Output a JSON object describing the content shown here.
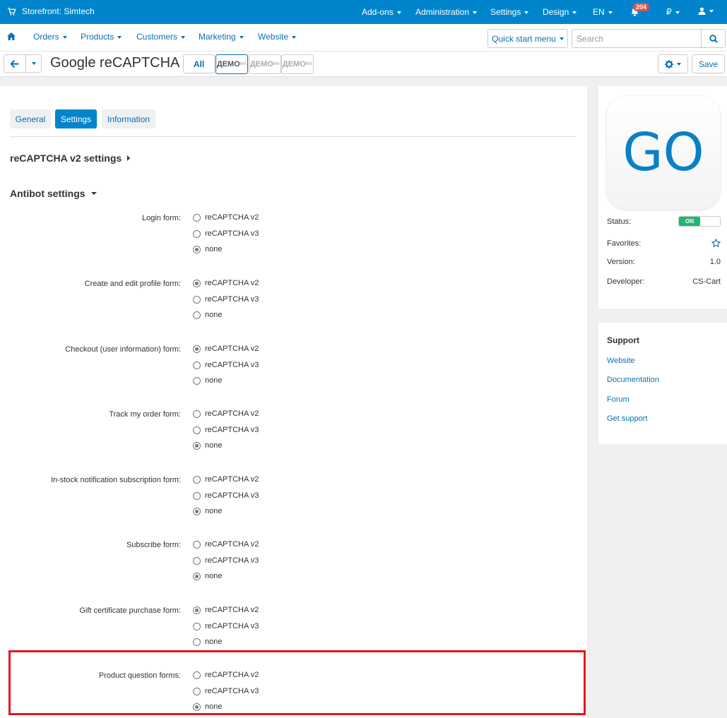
{
  "topbar": {
    "storefront": "Storefront: Simtech",
    "menus": [
      "Add-ons",
      "Administration",
      "Settings",
      "Design",
      "EN"
    ],
    "notifications_count": "204",
    "currency": "₽"
  },
  "nav": {
    "items": [
      "Orders",
      "Products",
      "Customers",
      "Marketing",
      "Website"
    ],
    "quick_start": "Quick start menu",
    "search_placeholder": "Search"
  },
  "header": {
    "title": "Google reCAPTCHA",
    "all_label": "All",
    "demo_label": "ДЕМО",
    "save_label": "Save"
  },
  "tabs": [
    "General",
    "Settings",
    "Information"
  ],
  "sections": {
    "recaptcha_v2": "reCAPTCHA v2 settings",
    "antibot": "Antibot settings"
  },
  "option_labels": [
    "reCAPTCHA v2",
    "reCAPTCHA v3",
    "none"
  ],
  "forms": [
    {
      "label": "Login form:",
      "selected": 2
    },
    {
      "label": "Create and edit profile form:",
      "selected": 0
    },
    {
      "label": "Checkout (user information) form:",
      "selected": 0
    },
    {
      "label": "Track my order form:",
      "selected": 2
    },
    {
      "label": "In-stock notification subscription form:",
      "selected": 2
    },
    {
      "label": "Subscribe form:",
      "selected": 2
    },
    {
      "label": "Gift certificate purchase form:",
      "selected": 0
    },
    {
      "label": "Product question forms:",
      "selected": 2
    }
  ],
  "addon_info": {
    "logo_text": "GO",
    "status_label": "Status:",
    "status_value": "ON",
    "favorites_label": "Favorites:",
    "version_label": "Version:",
    "version_value": "1.0",
    "developer_label": "Developer:",
    "developer_value": "CS-Cart"
  },
  "support": {
    "title": "Support",
    "links": [
      "Website",
      "Documentation",
      "Forum",
      "Get support"
    ]
  },
  "colors": {
    "brand_blue": "#0085cc",
    "link_blue": "#0a70b0",
    "status_on": "#22b573",
    "highlight_red": "#e8141e"
  }
}
